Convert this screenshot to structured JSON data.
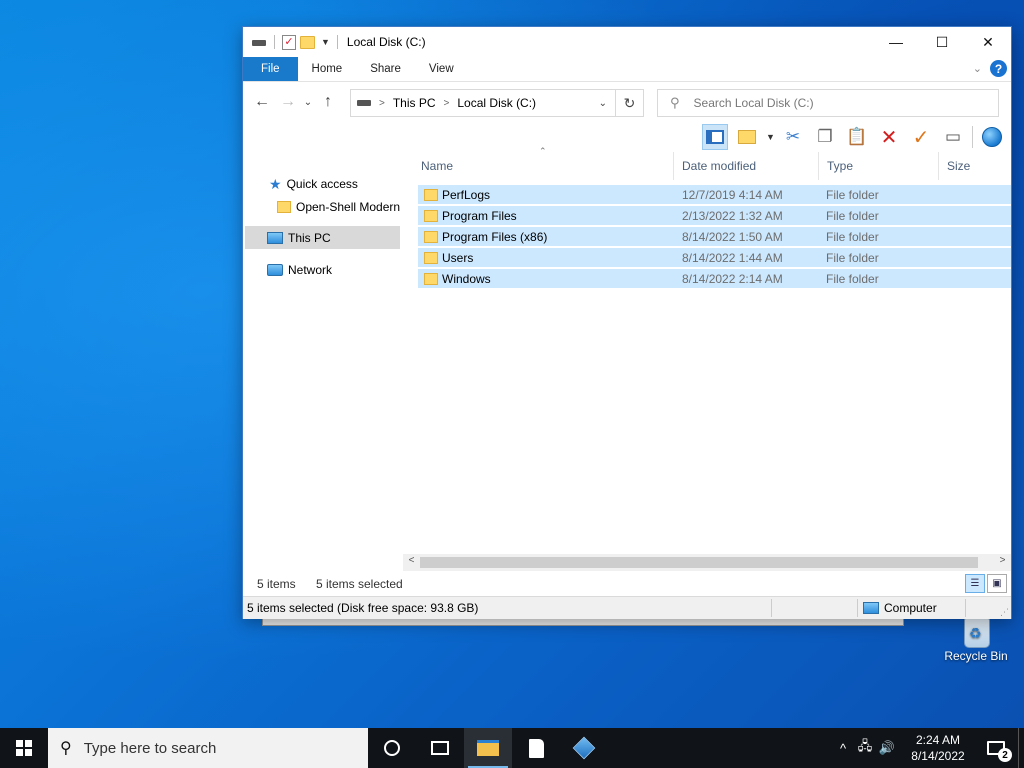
{
  "window": {
    "title": "Local Disk (C:)",
    "controls": {
      "minimize": "—",
      "maximize": "☐",
      "close": "✕"
    }
  },
  "ribbon": {
    "tabs": [
      "File",
      "Home",
      "Share",
      "View"
    ],
    "help": "?"
  },
  "address": {
    "crumbs": [
      "This PC",
      "Local Disk (C:)"
    ],
    "search_placeholder": "Search Local Disk (C:)"
  },
  "nav": {
    "quick_access": "Quick access",
    "pinned": "Open-Shell Modern",
    "this_pc": "This PC",
    "network": "Network"
  },
  "columns": [
    "Name",
    "Date modified",
    "Type",
    "Size"
  ],
  "files": [
    {
      "name": "PerfLogs",
      "date": "12/7/2019 4:14 AM",
      "type": "File folder"
    },
    {
      "name": "Program Files",
      "date": "2/13/2022 1:32 AM",
      "type": "File folder"
    },
    {
      "name": "Program Files (x86)",
      "date": "8/14/2022 1:50 AM",
      "type": "File folder"
    },
    {
      "name": "Users",
      "date": "8/14/2022 1:44 AM",
      "type": "File folder"
    },
    {
      "name": "Windows",
      "date": "8/14/2022 2:14 AM",
      "type": "File folder"
    }
  ],
  "status": {
    "item_count": "5 items",
    "selected": "5 items selected",
    "bottom": "5 items selected (Disk free space: 93.8 GB)",
    "location": "Computer"
  },
  "desktop": {
    "recycle_bin": "Recycle Bin"
  },
  "taskbar": {
    "search_placeholder": "Type here to search",
    "time": "2:24 AM",
    "date": "8/14/2022",
    "notifications": "2"
  },
  "colors": {
    "accent": "#1979ca",
    "selection": "#cce8ff",
    "taskbar": "#101418"
  }
}
